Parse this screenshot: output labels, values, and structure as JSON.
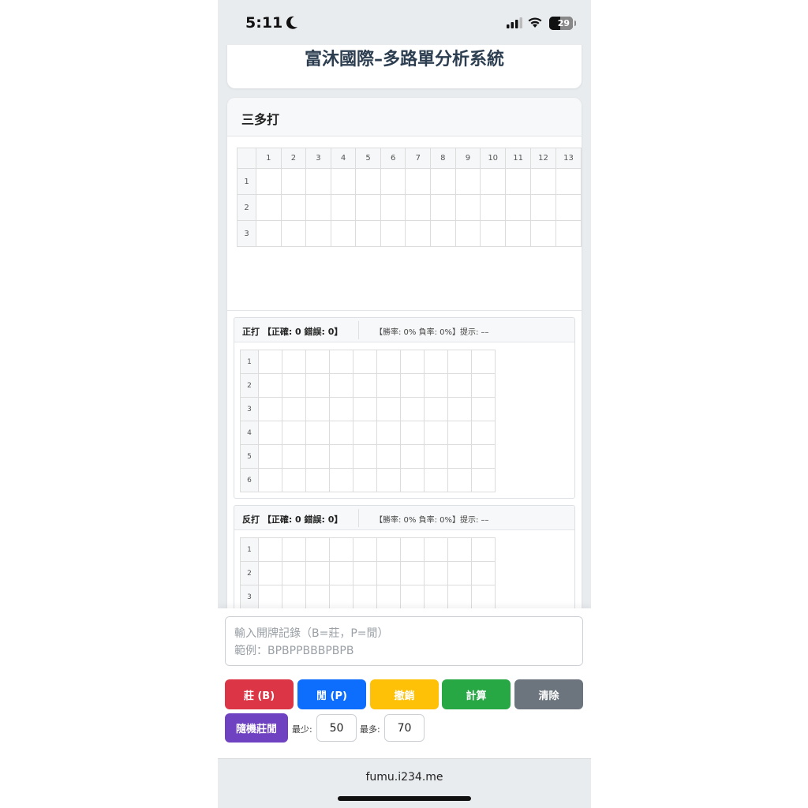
{
  "status_bar": {
    "time": "5:11",
    "battery": "29"
  },
  "page": {
    "title": "富沐國際–多路單分析系統"
  },
  "section": {
    "title": "三多打",
    "col_headers": [
      "1",
      "2",
      "3",
      "4",
      "5",
      "6",
      "7",
      "8",
      "9",
      "10",
      "11",
      "12",
      "13"
    ],
    "row_headers": [
      "1",
      "2",
      "3"
    ]
  },
  "panels": {
    "zheng": {
      "title": "正打 【正確: 0 錯誤: 0】",
      "stats": "【勝率: 0% 負率: 0%】提示: ––"
    },
    "fan": {
      "title": "反打 【正確: 0 錯誤: 0】",
      "stats": "【勝率: 0% 負率: 0%】提示: ––"
    },
    "small_row_headers": [
      "1",
      "2",
      "3",
      "4",
      "5",
      "6"
    ]
  },
  "controls": {
    "input_placeholder": "輸入開牌記錄（B=莊，P=閒）\n範例：BPBPPBBBPBPB",
    "banker_label": "莊 (B)",
    "player_label": "閒 (P)",
    "undo_label": "撤銷",
    "calc_label": "計算",
    "clear_label": "清除",
    "random_label": "隨機莊閒",
    "min_label": "最少:",
    "min_value": "50",
    "max_label": "最多:",
    "max_value": "70"
  },
  "browser": {
    "url": "fumu.i234.me"
  }
}
